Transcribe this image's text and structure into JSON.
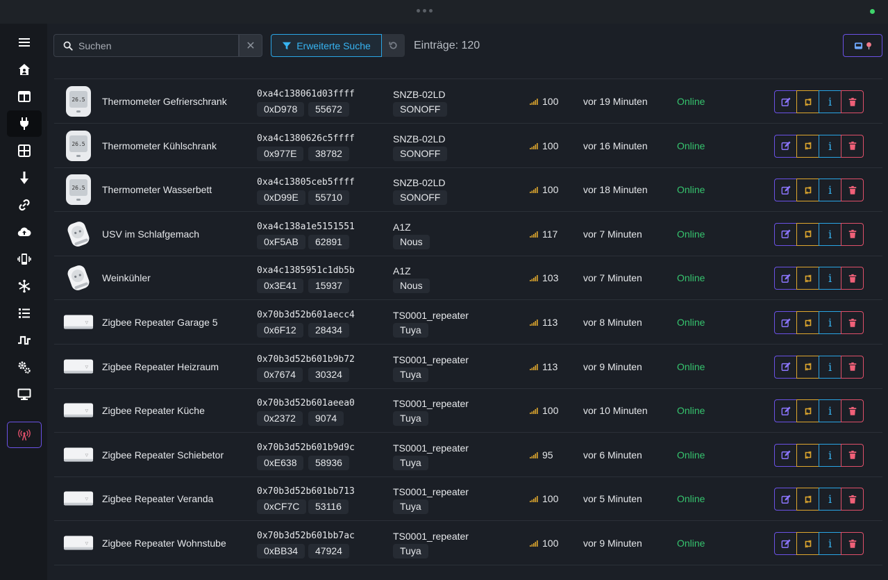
{
  "toolbar": {
    "search_placeholder": "Suchen",
    "advanced_search_label": "Erweiterte Suche",
    "entries_label": "Einträge: 120"
  },
  "colors": {
    "online": "#36c36e",
    "accent_purple": "#6b52e6",
    "accent_blue": "#2aa6e6",
    "accent_yellow": "#e0a82e",
    "accent_red": "#e0506a"
  },
  "sidebar": {
    "items": [
      {
        "icon": "menu-icon"
      },
      {
        "icon": "home-icon"
      },
      {
        "icon": "dashboard-icon"
      },
      {
        "icon": "plug-icon",
        "active": true
      },
      {
        "icon": "grid-icon"
      },
      {
        "icon": "arrow-down-icon"
      },
      {
        "icon": "link-icon"
      },
      {
        "icon": "cloud-upload-icon"
      },
      {
        "icon": "vibrate-icon"
      },
      {
        "icon": "network-icon"
      },
      {
        "icon": "list-icon"
      },
      {
        "icon": "pulse-icon"
      },
      {
        "icon": "cogs-icon"
      },
      {
        "icon": "monitor-icon"
      },
      {
        "icon": "radio-tower-icon"
      }
    ]
  },
  "devices": [
    {
      "type": "thermo",
      "name": "Thermometer Gefrierschrank",
      "ieee": "0xa4c138061d03ffff",
      "nwk": "0xD978",
      "pan": "55672",
      "model": "SNZB-02LD",
      "vendor": "SONOFF",
      "lqi": "100",
      "last_seen": "vor 19 Minuten",
      "state": "Online"
    },
    {
      "type": "thermo",
      "name": "Thermometer Kühlschrank",
      "ieee": "0xa4c1380626c5ffff",
      "nwk": "0x977E",
      "pan": "38782",
      "model": "SNZB-02LD",
      "vendor": "SONOFF",
      "lqi": "100",
      "last_seen": "vor 16 Minuten",
      "state": "Online"
    },
    {
      "type": "thermo",
      "name": "Thermometer Wasserbett",
      "ieee": "0xa4c13805ceb5ffff",
      "nwk": "0xD99E",
      "pan": "55710",
      "model": "SNZB-02LD",
      "vendor": "SONOFF",
      "lqi": "100",
      "last_seen": "vor 18 Minuten",
      "state": "Online"
    },
    {
      "type": "plug",
      "name": "USV im Schlafgemach",
      "ieee": "0xa4c138a1e5151551",
      "nwk": "0xF5AB",
      "pan": "62891",
      "model": "A1Z",
      "vendor": "Nous",
      "lqi": "117",
      "last_seen": "vor 7 Minuten",
      "state": "Online"
    },
    {
      "type": "plug",
      "name": "Weinkühler",
      "ieee": "0xa4c1385951c1db5b",
      "nwk": "0x3E41",
      "pan": "15937",
      "model": "A1Z",
      "vendor": "Nous",
      "lqi": "103",
      "last_seen": "vor 7 Minuten",
      "state": "Online"
    },
    {
      "type": "repeater",
      "name": "Zigbee Repeater Garage 5",
      "ieee": "0x70b3d52b601aecc4",
      "nwk": "0x6F12",
      "pan": "28434",
      "model": "TS0001_repeater",
      "vendor": "Tuya",
      "lqi": "113",
      "last_seen": "vor 8 Minuten",
      "state": "Online"
    },
    {
      "type": "repeater",
      "name": "Zigbee Repeater Heizraum",
      "ieee": "0x70b3d52b601b9b72",
      "nwk": "0x7674",
      "pan": "30324",
      "model": "TS0001_repeater",
      "vendor": "Tuya",
      "lqi": "113",
      "last_seen": "vor 9 Minuten",
      "state": "Online"
    },
    {
      "type": "repeater",
      "name": "Zigbee Repeater Küche",
      "ieee": "0x70b3d52b601aeea0",
      "nwk": "0x2372",
      "pan": "9074",
      "model": "TS0001_repeater",
      "vendor": "Tuya",
      "lqi": "100",
      "last_seen": "vor 10 Minuten",
      "state": "Online"
    },
    {
      "type": "repeater",
      "name": "Zigbee Repeater Schiebetor",
      "ieee": "0x70b3d52b601b9d9c",
      "nwk": "0xE638",
      "pan": "58936",
      "model": "TS0001_repeater",
      "vendor": "Tuya",
      "lqi": "95",
      "last_seen": "vor 6 Minuten",
      "state": "Online"
    },
    {
      "type": "repeater",
      "name": "Zigbee Repeater Veranda",
      "ieee": "0x70b3d52b601bb713",
      "nwk": "0xCF7C",
      "pan": "53116",
      "model": "TS0001_repeater",
      "vendor": "Tuya",
      "lqi": "100",
      "last_seen": "vor 5 Minuten",
      "state": "Online"
    },
    {
      "type": "repeater",
      "name": "Zigbee Repeater Wohnstube",
      "ieee": "0x70b3d52b601bb7ac",
      "nwk": "0xBB34",
      "pan": "47924",
      "model": "TS0001_repeater",
      "vendor": "Tuya",
      "lqi": "100",
      "last_seen": "vor 9 Minuten",
      "state": "Online"
    }
  ]
}
